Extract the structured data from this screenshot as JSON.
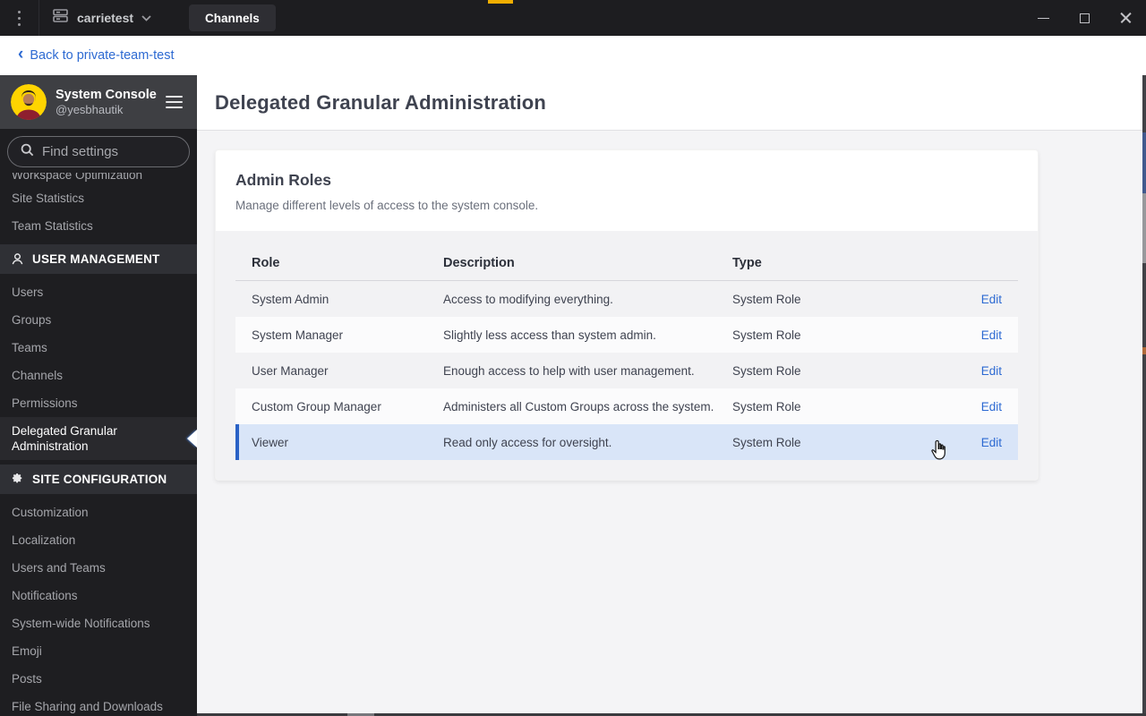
{
  "titlebar": {
    "team_name": "carrietest",
    "tab_label": "Channels",
    "icons": [
      "kebab-menu-icon",
      "server-icon",
      "chevron-down-icon",
      "minimize-icon",
      "maximize-icon",
      "close-icon"
    ]
  },
  "backbar": {
    "chevron": "‹",
    "label": "Back to private-team-test"
  },
  "sidebar": {
    "title": "System Console",
    "subtitle": "@yesbhautik",
    "search_placeholder": "Find settings",
    "cut_item": "Workspace Optimization",
    "top_items": [
      "Site Statistics",
      "Team Statistics"
    ],
    "sections": [
      {
        "header": "USER MANAGEMENT",
        "icon": "user-icon",
        "items": [
          "Users",
          "Groups",
          "Teams",
          "Channels",
          "Permissions",
          "Delegated Granular Administration"
        ],
        "selected_index": 5
      },
      {
        "header": "SITE CONFIGURATION",
        "icon": "gear-icon",
        "items": [
          "Customization",
          "Localization",
          "Users and Teams",
          "Notifications",
          "System-wide Notifications",
          "Emoji",
          "Posts",
          "File Sharing and Downloads"
        ],
        "selected_index": -1
      }
    ]
  },
  "main": {
    "page_title": "Delegated Granular Administration",
    "card": {
      "title": "Admin Roles",
      "subtitle": "Manage different levels of access to the system console.",
      "table": {
        "headers": [
          "Role",
          "Description",
          "Type"
        ],
        "edit_label": "Edit",
        "rows": [
          {
            "role": "System Admin",
            "description": "Access to modifying everything.",
            "type": "System Role",
            "highlighted": false
          },
          {
            "role": "System Manager",
            "description": "Slightly less access than system admin.",
            "type": "System Role",
            "highlighted": false
          },
          {
            "role": "User Manager",
            "description": "Enough access to help with user management.",
            "type": "System Role",
            "highlighted": false
          },
          {
            "role": "Custom Group Manager",
            "description": "Administers all Custom Groups across the system.",
            "type": "System Role",
            "highlighted": false
          },
          {
            "role": "Viewer",
            "description": "Read only access for oversight.",
            "type": "System Role",
            "highlighted": true
          }
        ]
      }
    }
  },
  "colors": {
    "titlebar_bg": "#1d1d20",
    "sidebar_bg": "#1e1e21",
    "sidebar_header_bg": "#3e3f43",
    "section_header_bg": "#2f3035",
    "accent_link": "#2d6ad2",
    "row_highlight_bg": "#d9e5f8",
    "row_highlight_border": "#2a62c6",
    "content_bg": "#f4f4f6",
    "avatar_bg": "#ffd400",
    "titlebar_speck": "#f0ae00"
  }
}
